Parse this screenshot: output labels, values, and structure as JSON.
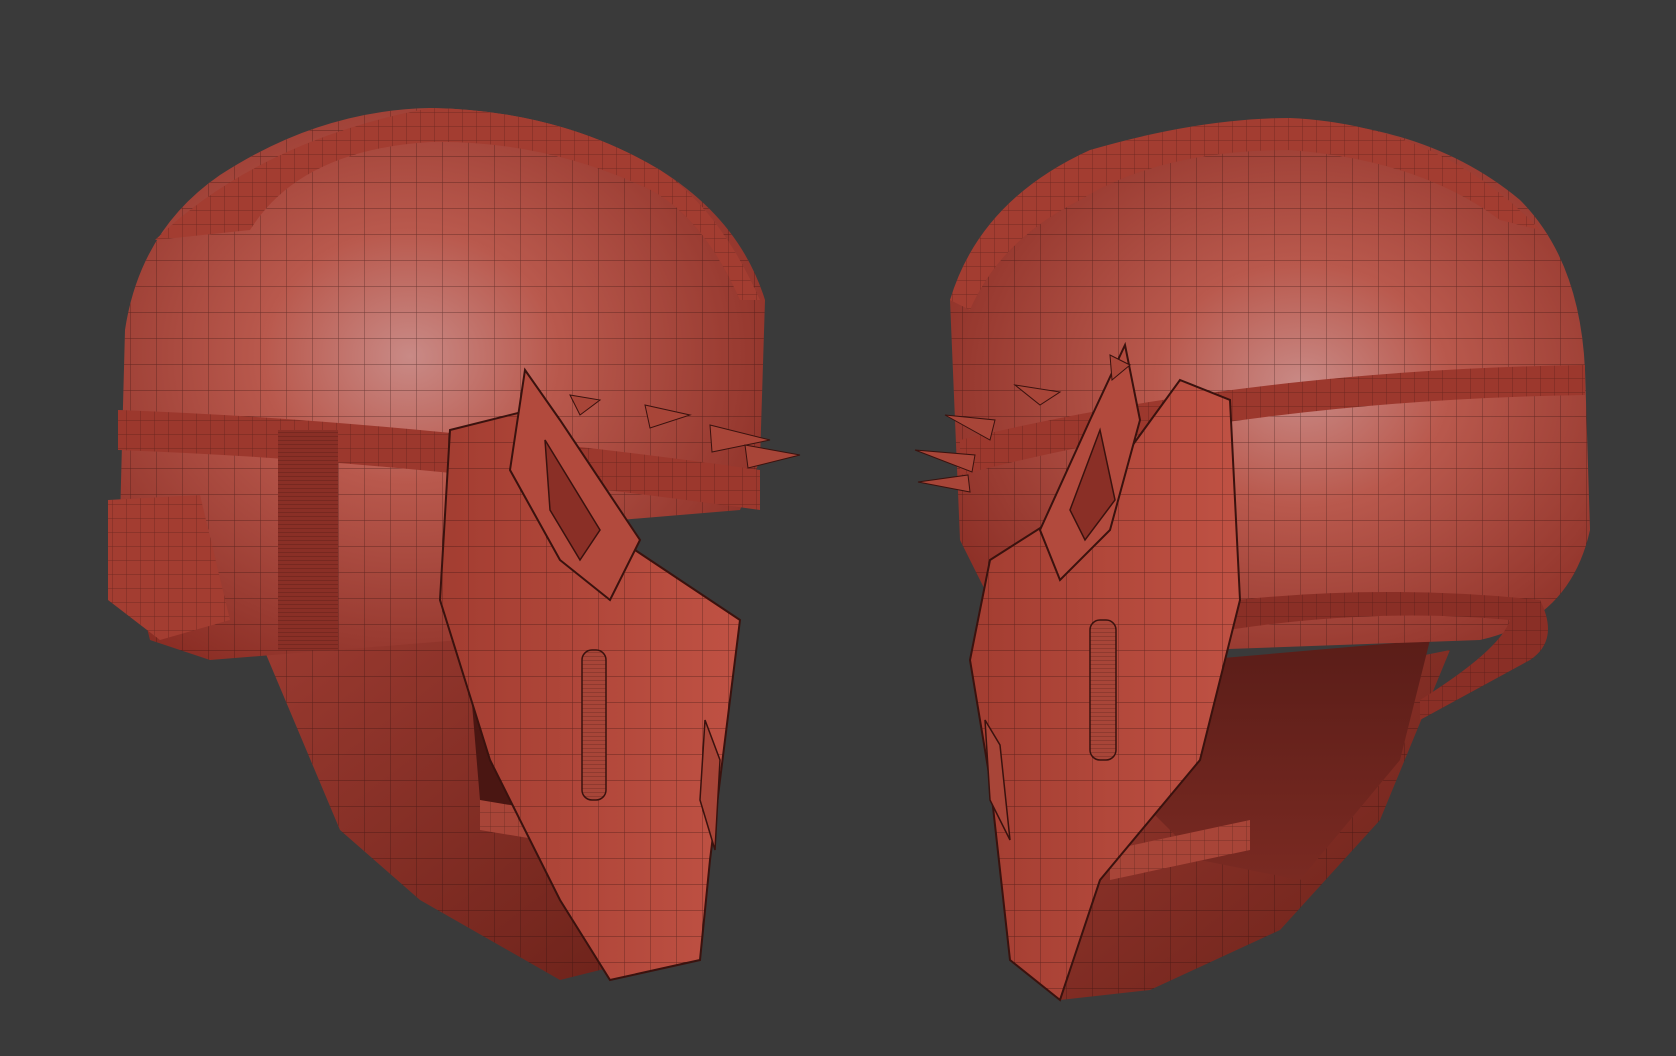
{
  "scene": {
    "background_color": "#3a3a3a",
    "material_base_color": "#b94a3c",
    "material_highlight_color": "#c98a86",
    "material_shadow_color": "#5a1d18",
    "wire_color": "#2a0d0a",
    "objects": [
      {
        "name": "helmet-left-view",
        "facing": "right"
      },
      {
        "name": "helmet-right-view",
        "facing": "left"
      }
    ]
  }
}
